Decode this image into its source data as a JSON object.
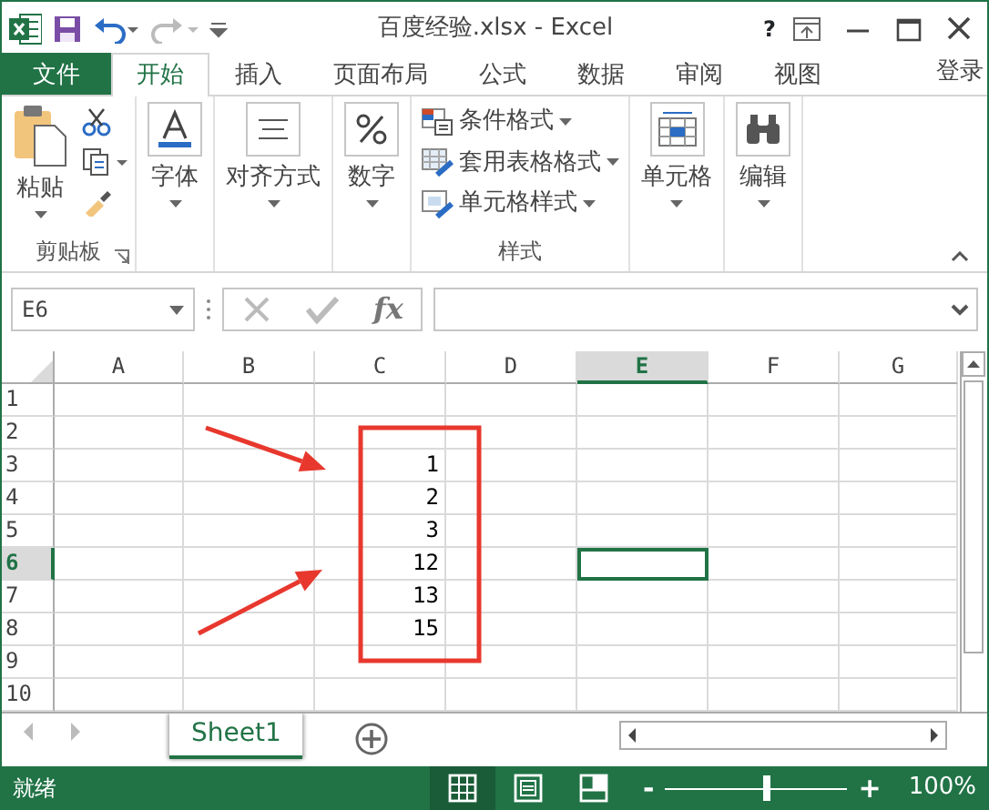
{
  "window": {
    "title": "百度经验.xlsx - Excel",
    "help": "?"
  },
  "tabs": [
    {
      "label": "文件",
      "kind": "file",
      "selected": false
    },
    {
      "label": "开始",
      "kind": "tab",
      "selected": true
    },
    {
      "label": "插入",
      "kind": "tab",
      "selected": false
    },
    {
      "label": "页面布局",
      "kind": "tab",
      "selected": false
    },
    {
      "label": "公式",
      "kind": "tab",
      "selected": false
    },
    {
      "label": "数据",
      "kind": "tab",
      "selected": false
    },
    {
      "label": "审阅",
      "kind": "tab",
      "selected": false
    },
    {
      "label": "视图",
      "kind": "tab",
      "selected": false
    }
  ],
  "account": "登录",
  "ribbon": {
    "groups": [
      {
        "label": "剪贴板",
        "kind": "clipboard",
        "buttons": [
          {
            "label": "粘贴"
          }
        ]
      },
      {
        "kind": "large",
        "buttons": [
          {
            "label": "字体"
          }
        ]
      },
      {
        "kind": "large",
        "buttons": [
          {
            "label": "对齐方式"
          }
        ]
      },
      {
        "kind": "large",
        "buttons": [
          {
            "label": "数字"
          }
        ]
      },
      {
        "label": "样式",
        "kind": "small",
        "buttons": [
          {
            "label": "条件格式"
          },
          {
            "label": "套用表格格式"
          },
          {
            "label": "单元格样式"
          }
        ]
      },
      {
        "kind": "large",
        "buttons": [
          {
            "label": "单元格"
          }
        ]
      },
      {
        "kind": "large",
        "buttons": [
          {
            "label": "编辑"
          }
        ]
      }
    ]
  },
  "formula_bar": {
    "name_box": "E6",
    "function_label": "fx"
  },
  "columns": [
    {
      "label": "A",
      "selected": false
    },
    {
      "label": "B",
      "selected": false
    },
    {
      "label": "C",
      "selected": false
    },
    {
      "label": "D",
      "selected": false
    },
    {
      "label": "E",
      "selected": true
    },
    {
      "label": "F",
      "selected": false
    },
    {
      "label": "G",
      "selected": false
    }
  ],
  "rows": [
    {
      "label": "1",
      "selected": false,
      "cells": []
    },
    {
      "label": "2",
      "selected": false,
      "cells": []
    },
    {
      "label": "3",
      "selected": false,
      "cells": [
        null,
        null,
        "1"
      ]
    },
    {
      "label": "4",
      "selected": false,
      "cells": [
        null,
        null,
        "2"
      ]
    },
    {
      "label": "5",
      "selected": false,
      "cells": [
        null,
        null,
        "3"
      ]
    },
    {
      "label": "6",
      "selected": true,
      "cells": [
        null,
        null,
        "12"
      ]
    },
    {
      "label": "7",
      "selected": false,
      "cells": [
        null,
        null,
        "13"
      ]
    },
    {
      "label": "8",
      "selected": false,
      "cells": [
        null,
        null,
        "15"
      ]
    },
    {
      "label": "9",
      "selected": false,
      "cells": []
    },
    {
      "label": "10",
      "selected": false,
      "cells": []
    }
  ],
  "annotations": [
    {
      "kind": "box"
    },
    {
      "kind": "arrow"
    },
    {
      "kind": "arrow"
    }
  ],
  "sheet_tabs": [
    {
      "label": "Sheet1",
      "selected": true
    }
  ],
  "status_bar": {
    "text": "就绪",
    "views": [
      {
        "selected": true
      },
      {
        "selected": false
      },
      {
        "selected": false
      }
    ],
    "zoom_out": "-",
    "zoom_in": "+",
    "zoom": {
      "level": 0.56,
      "reading": "100%"
    }
  }
}
